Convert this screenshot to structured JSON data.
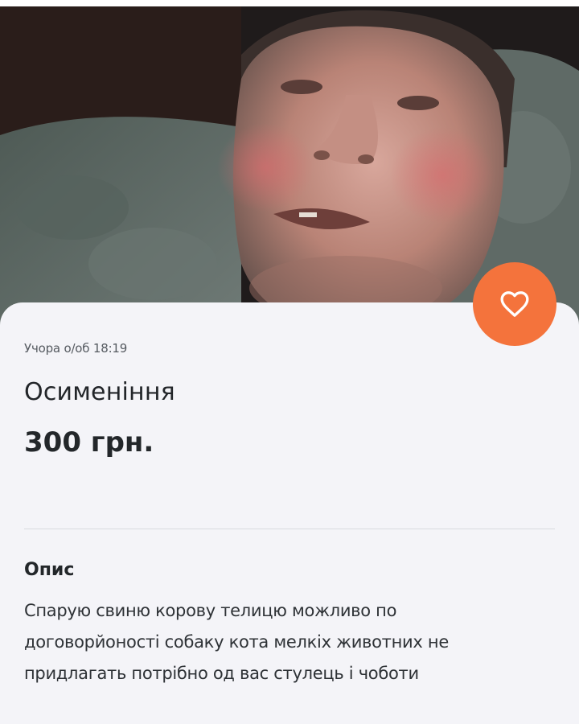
{
  "listing": {
    "photo_alt": "listing-photo",
    "posted_date": "Учора о/об 18:19",
    "title": "Осименіння",
    "price": "300 грн.",
    "favorite_icon": "heart-icon"
  },
  "description": {
    "heading": "Опис",
    "lines": [
      "Спарую свиню корову телицю можливо по",
      "договорйоності собаку кота мелкіх животних не",
      "придлагать потрібно од вас стулець і чоботи"
    ]
  },
  "colors": {
    "accent": "#f4733c",
    "card_background": "#f4f4f8",
    "text_primary": "#23272a",
    "text_secondary": "#555a60"
  }
}
